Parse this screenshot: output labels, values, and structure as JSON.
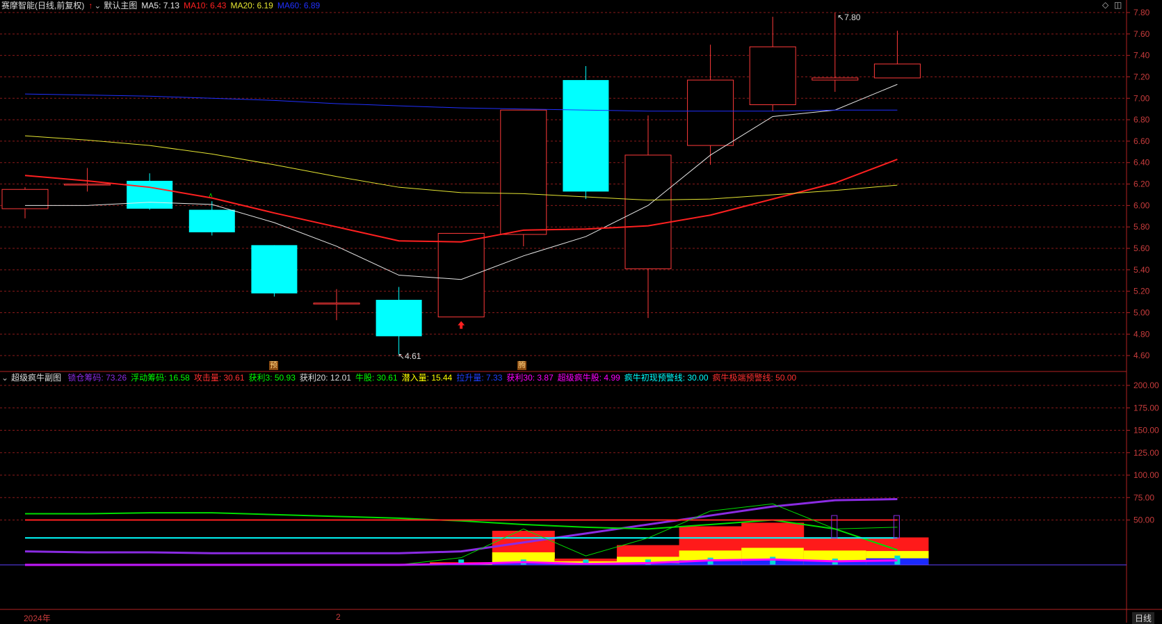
{
  "main_header": {
    "title": "赛摩智能(日线,前复权)",
    "chart_name": "默认主图",
    "ma5": "MA5: 7.13",
    "ma10": "MA10: 6.43",
    "ma20": "MA20: 6.19",
    "ma60": "MA60: 6.89"
  },
  "sub_header": {
    "name": "超级疯牛副图",
    "items": [
      {
        "text": "锁仓筹码: 73.26",
        "color": "#8a2be2"
      },
      {
        "text": "浮动筹码: 16.58",
        "color": "#00ff00"
      },
      {
        "text": "攻击量: 30.61",
        "color": "#ff3030"
      },
      {
        "text": "获利3: 50.93",
        "color": "#00ff00"
      },
      {
        "text": "获利20: 12.01",
        "color": "#dddddd"
      },
      {
        "text": "牛股: 30.61",
        "color": "#00ff00"
      },
      {
        "text": "潜入量: 15.44",
        "color": "#ffff00"
      },
      {
        "text": "拉升量: 7.33",
        "color": "#2040ff"
      },
      {
        "text": "获利30: 3.87",
        "color": "#ff00ff"
      },
      {
        "text": "超级疯牛股: 4.99",
        "color": "#ff00ff"
      },
      {
        "text": "疯牛初现预警线: 30.00",
        "color": "#00ffff"
      },
      {
        "text": "疯牛极端预警线: 50.00",
        "color": "#ff3030"
      }
    ]
  },
  "annotations": {
    "high_label": "7.80",
    "low_label": "4.61",
    "signal_yu": "预",
    "signal_teng": "腾",
    "x_label_year": "2024年",
    "x_label_month": "2",
    "period_button": "日线"
  },
  "colors": {
    "up": "#ff3a3a",
    "down": "#00ffff",
    "ma5": "#e8e8e8",
    "ma10": "#ff2020",
    "ma20": "#e6e632",
    "ma60": "#2030ff",
    "grid": "#8b1a1a",
    "axis": "#b22222"
  },
  "chart_data": [
    {
      "type": "candlestick",
      "title": "赛摩智能(日线,前复权)",
      "ylim": [
        4.5,
        7.9
      ],
      "yticks": [
        "4.60",
        "4.80",
        "5.00",
        "5.20",
        "5.40",
        "5.60",
        "5.80",
        "6.00",
        "6.20",
        "6.40",
        "6.60",
        "6.80",
        "7.00",
        "7.20",
        "7.40",
        "7.60",
        "7.80"
      ],
      "candles": [
        {
          "o": 5.97,
          "h": 6.17,
          "l": 5.88,
          "c": 6.15
        },
        {
          "o": 6.2,
          "h": 6.35,
          "l": 6.13,
          "c": 6.2
        },
        {
          "o": 6.23,
          "h": 6.3,
          "l": 5.96,
          "c": 5.97
        },
        {
          "o": 5.96,
          "h": 6.04,
          "l": 5.72,
          "c": 5.75
        },
        {
          "o": 5.63,
          "h": 5.63,
          "l": 5.15,
          "c": 5.18
        },
        {
          "o": 5.09,
          "h": 5.22,
          "l": 4.93,
          "c": 5.09
        },
        {
          "o": 5.12,
          "h": 5.24,
          "l": 4.61,
          "c": 4.78
        },
        {
          "o": 4.96,
          "h": 5.74,
          "l": 4.96,
          "c": 5.74
        },
        {
          "o": 5.73,
          "h": 6.89,
          "l": 5.62,
          "c": 6.89
        },
        {
          "o": 7.17,
          "h": 7.3,
          "l": 6.06,
          "c": 6.13
        },
        {
          "o": 5.41,
          "h": 6.84,
          "l": 4.95,
          "c": 6.47
        },
        {
          "o": 6.56,
          "h": 7.5,
          "l": 6.38,
          "c": 7.17
        },
        {
          "o": 6.94,
          "h": 7.76,
          "l": 6.88,
          "c": 7.48
        },
        {
          "o": 7.17,
          "h": 7.8,
          "l": 7.06,
          "c": 7.19
        },
        {
          "o": 7.19,
          "h": 7.63,
          "l": 7.19,
          "c": 7.32
        }
      ],
      "series": [
        {
          "name": "MA5",
          "values": [
            6.0,
            6.0,
            6.03,
            6.01,
            5.84,
            5.62,
            5.35,
            5.31,
            5.53,
            5.71,
            6.0,
            6.47,
            6.83,
            6.89,
            7.13
          ]
        },
        {
          "name": "MA10",
          "values": [
            6.28,
            6.23,
            6.17,
            6.07,
            5.93,
            5.8,
            5.67,
            5.66,
            5.77,
            5.78,
            5.81,
            5.91,
            6.06,
            6.21,
            6.43
          ]
        },
        {
          "name": "MA20",
          "values": [
            6.65,
            6.61,
            6.56,
            6.48,
            6.38,
            6.27,
            6.17,
            6.12,
            6.11,
            6.08,
            6.05,
            6.06,
            6.1,
            6.14,
            6.19
          ]
        },
        {
          "name": "MA60",
          "values": [
            7.04,
            7.03,
            7.02,
            7.0,
            6.98,
            6.95,
            6.93,
            6.91,
            6.9,
            6.89,
            6.88,
            6.88,
            6.88,
            6.89,
            6.89
          ]
        }
      ]
    },
    {
      "type": "line",
      "title": "超级疯牛副图",
      "ylim": [
        -50,
        215
      ],
      "yticks": [
        "50.00",
        "75.00",
        "100.00",
        "125.00",
        "150.00",
        "175.00",
        "200.00"
      ],
      "series": [
        {
          "name": "锁仓筹码",
          "values": [
            15,
            14,
            14,
            13,
            13,
            13,
            13,
            15,
            25,
            35,
            45,
            55,
            65,
            72,
            73.26
          ]
        },
        {
          "name": "浮动筹码",
          "values": [
            57,
            57,
            58,
            58,
            56,
            54,
            52,
            49,
            45,
            42,
            40,
            45,
            50,
            40,
            16.58
          ]
        },
        {
          "name": "疯牛初现预警线",
          "values": [
            30,
            30,
            30,
            30,
            30,
            30,
            30,
            30,
            30,
            30,
            30,
            30,
            30,
            30,
            30
          ]
        },
        {
          "name": "疯牛极端预警线",
          "values": [
            50,
            50,
            50,
            50,
            50,
            50,
            50,
            50,
            50,
            50,
            50,
            50,
            50,
            50,
            50
          ]
        }
      ],
      "bars": {
        "攻击量": [
          0,
          0,
          0,
          0,
          0,
          0,
          0,
          3,
          38,
          7,
          22,
          43,
          47,
          30,
          30.61
        ],
        "潜入量": [
          0,
          0,
          0,
          0,
          0,
          0,
          0,
          2,
          14,
          4,
          9,
          16,
          19,
          16,
          15.44
        ],
        "拉升量": [
          0,
          0,
          0,
          0,
          0,
          0,
          0,
          0,
          3,
          1,
          2,
          5,
          6,
          4,
          7.33
        ]
      }
    }
  ]
}
